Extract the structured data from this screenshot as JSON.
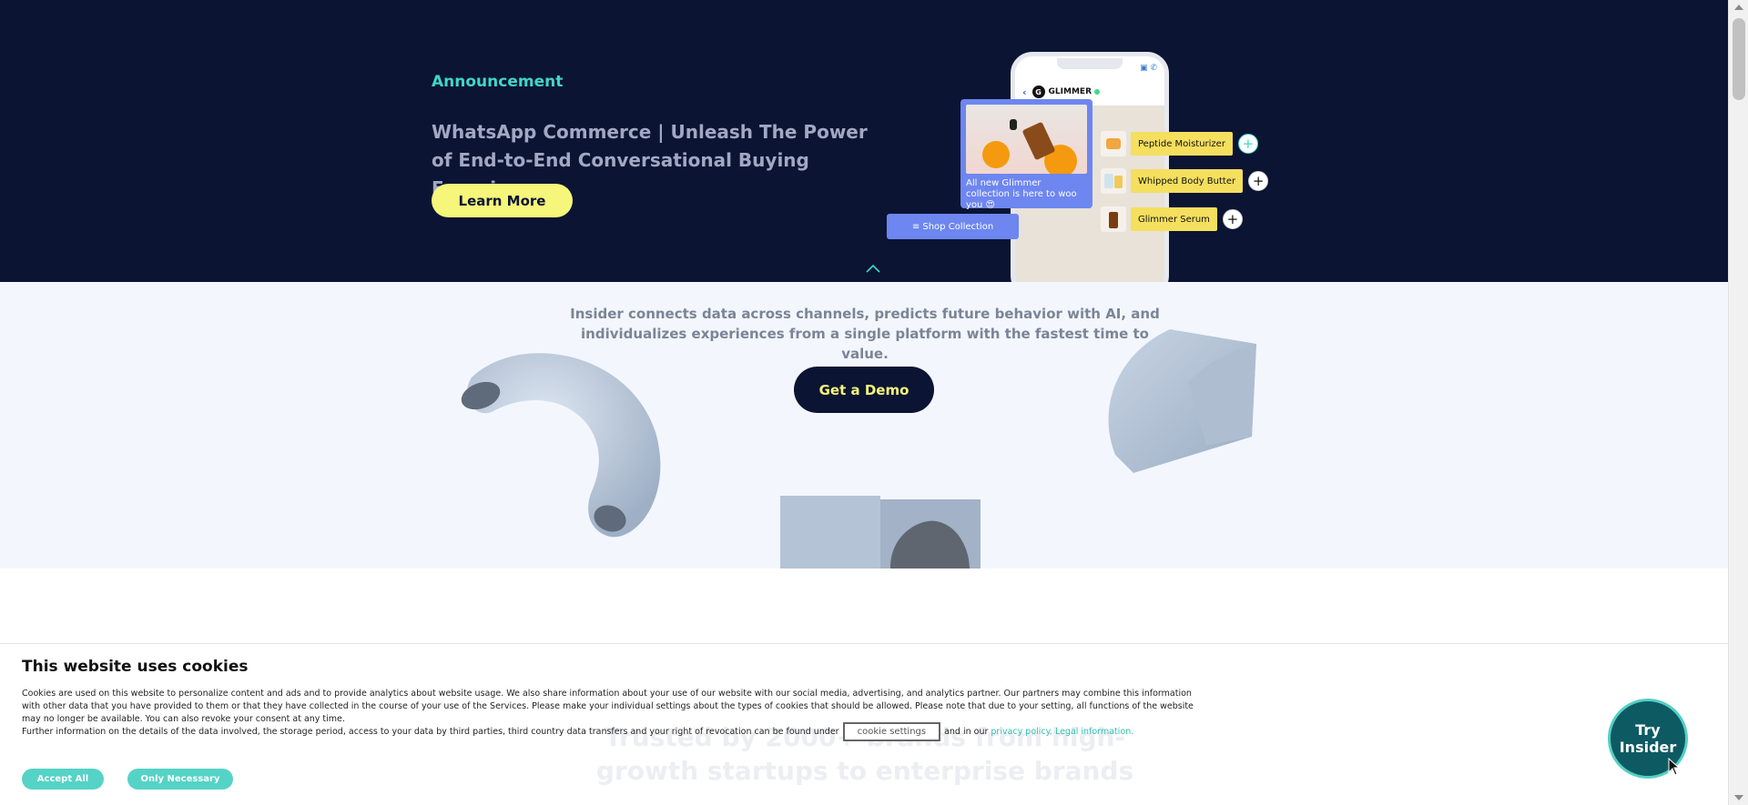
{
  "hero": {
    "announcement": "Announcement",
    "title": "WhatsApp Commerce | Unleash The Power of End-to-End Conversational Buying Experiences",
    "cta": "Learn More",
    "phone": {
      "brand": "GLIMMER",
      "brand_initial": "G",
      "promo_text": "All new Glimmer collection is here to woo you 😍",
      "shop_button": "Shop Collection",
      "products": [
        {
          "name": "Peptide Moisturizer"
        },
        {
          "name": "Whipped Body Butter"
        },
        {
          "name": "Glimmer Serum"
        }
      ],
      "plus": "+"
    }
  },
  "intro": {
    "tagline": "Insider connects data across channels, predicts future behavior with AI, and individualizes experiences from a single platform with the fastest time to value.",
    "demo_button": "Get a Demo"
  },
  "behind_banner": {
    "heading": "Trusted by 2000+ brands from high-growth startups to enterprise brands"
  },
  "cookie": {
    "title": "This website uses cookies",
    "text": "Cookies are used on this website to personalize content and ads and to provide analytics about website usage. We also share information about your use of our website with our social media, advertising, and analytics partner. Our partners may combine this information with other data that you have provided to them or that they have collected in the course of your use of the Services. Please make your individual settings about the types of cookies that should be allowed. Please note that due to your setting, all functions of the website may no longer be available. You can also revoke your consent at any time.",
    "further_info": "Further information on the details of the data involved, the storage period, access to your data by third parties, third country data transfers and your right of revocation can be found under",
    "settings_button": "cookie settings",
    "and_in_our": "and in our",
    "privacy_link": "privacy policy.",
    "legal_link": "Legal information.",
    "accept_all": "Accept All",
    "only_necessary": "Only Necessary"
  },
  "floating": {
    "try_insider": "Try\nInsider"
  },
  "colors": {
    "navy": "#0b1433",
    "teal": "#3fd7c6",
    "yellow": "#f6f67a",
    "light_bg": "#f3f7fd",
    "periwinkle": "#6d86f0"
  },
  "icons": [
    "chevron-up-icon",
    "back-arrow-icon",
    "video-icon",
    "phone-icon",
    "list-icon",
    "plus-icon",
    "cursor-icon"
  ]
}
